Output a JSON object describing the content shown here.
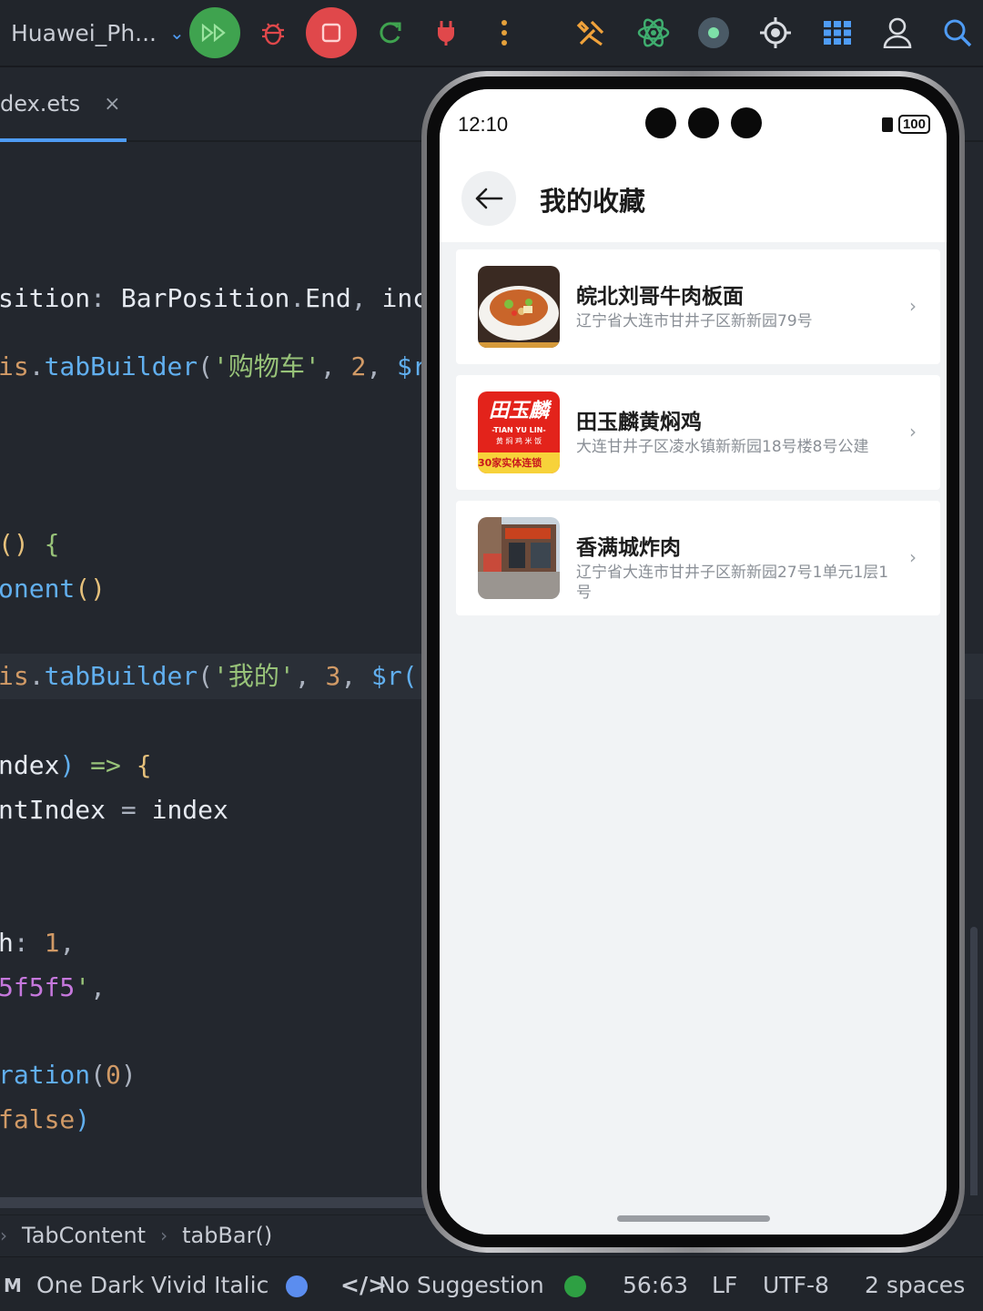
{
  "toolbar": {
    "device": "Huawei_Ph...",
    "icons": [
      "chevron-down-icon",
      "run-icon",
      "debug-bug-icon",
      "stop-icon",
      "rerun-icon",
      "plug-icon",
      "more-vertical-icon",
      "build-tools-icon",
      "atom-icon",
      "record-icon",
      "target-icon",
      "grid-icon",
      "user-icon",
      "search-icon"
    ],
    "colors": {
      "run": "#3fa34f",
      "stop": "#e0484b",
      "accent": "#4f9cf5"
    }
  },
  "editor_tab": {
    "filename": "dex.ets",
    "close": "×"
  },
  "code": {
    "lines": [
      {
        "text": "sition: BarPosition.End, inc"
      },
      {
        "text": "is.tabBuilder('购物车', 2, $r"
      },
      {
        "text": "() {"
      },
      {
        "text": "onent()"
      },
      {
        "text": "is.tabBuilder('我的', 3, $r("
      },
      {
        "text": "ndex) => {"
      },
      {
        "text": "ntIndex = index"
      },
      {
        "text": "h: 1,"
      },
      {
        "text": "5f5f5',"
      },
      {
        "text": "ration(0)"
      },
      {
        "text": "false)"
      }
    ]
  },
  "breadcrumb": {
    "items": [
      "TabContent",
      "tabBar()"
    ]
  },
  "status": {
    "theme": "One Dark Vivid Italic",
    "suggestion": "No Suggestion",
    "position": "56:63",
    "line_ending": "LF",
    "encoding": "UTF-8",
    "indent": "2 spaces"
  },
  "phone": {
    "time": "12:10",
    "battery": "100",
    "title": "我的收藏",
    "favorites": [
      {
        "name": "皖北刘哥牛肉板面",
        "address": "辽宁省大连市甘井子区新新园79号",
        "thumb": "noodle-dish"
      },
      {
        "name": "田玉麟黄焖鸡",
        "address": "大连甘井子区凌水镇新新园18号楼8号公建",
        "thumb": "brand-logo",
        "logo_text": "田玉麟",
        "logo_sub": "-TIAN YU LIN-",
        "logo_sub2": "黄 焖 鸡 米 饭",
        "logo_badge": "30家实体连锁"
      },
      {
        "name": "香满城炸肉",
        "address": "辽宁省大连市甘井子区新新园27号1单元1层1号",
        "thumb": "storefront"
      }
    ]
  }
}
